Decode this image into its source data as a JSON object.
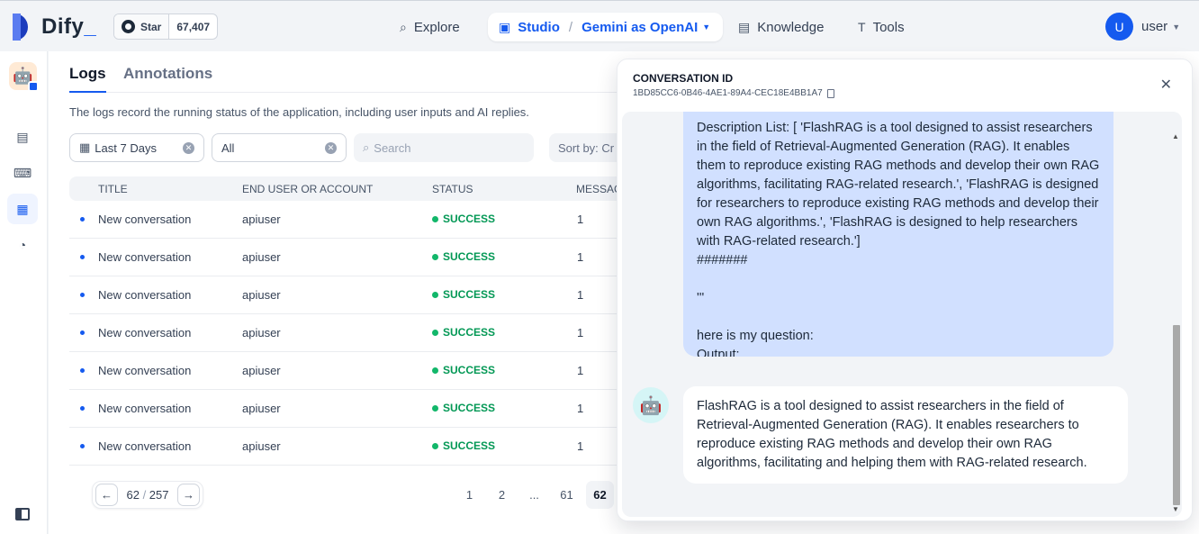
{
  "brand": {
    "name": "Dify",
    "underscore": "_"
  },
  "github": {
    "label": "Star",
    "count": "67,407"
  },
  "nav": {
    "explore": "Explore",
    "studio": "Studio",
    "app_name": "Gemini as OpenAI",
    "knowledge": "Knowledge",
    "tools": "Tools"
  },
  "user": {
    "initial": "U",
    "name": "user"
  },
  "tabs": {
    "logs": "Logs",
    "annotations": "Annotations"
  },
  "description": "The logs record the running status of the application, including user inputs and AI replies.",
  "filters": {
    "date": "Last 7 Days",
    "status": "All",
    "search_placeholder": "Search",
    "sort": "Sort by: Cr"
  },
  "table": {
    "headers": [
      "TITLE",
      "END USER OR ACCOUNT",
      "STATUS",
      "MESSAG"
    ],
    "rows": [
      {
        "title": "New conversation",
        "user": "apiuser",
        "status": "SUCCESS",
        "messages": "1"
      },
      {
        "title": "New conversation",
        "user": "apiuser",
        "status": "SUCCESS",
        "messages": "1"
      },
      {
        "title": "New conversation",
        "user": "apiuser",
        "status": "SUCCESS",
        "messages": "1"
      },
      {
        "title": "New conversation",
        "user": "apiuser",
        "status": "SUCCESS",
        "messages": "1"
      },
      {
        "title": "New conversation",
        "user": "apiuser",
        "status": "SUCCESS",
        "messages": "1"
      },
      {
        "title": "New conversation",
        "user": "apiuser",
        "status": "SUCCESS",
        "messages": "1"
      },
      {
        "title": "New conversation",
        "user": "apiuser",
        "status": "SUCCESS",
        "messages": "1"
      }
    ]
  },
  "pagination": {
    "current": "62",
    "total": "257",
    "pages": [
      "1",
      "2",
      "...",
      "61",
      "62"
    ]
  },
  "drawer": {
    "title": "CONVERSATION ID",
    "conversation_id": "1BD85CC6-0B46-4AE1-89A4-CEC18E4BB1A7",
    "question": "Description List: [ 'FlashRAG is a tool designed to assist researchers in the field of Retrieval-Augmented Generation (RAG). It enables them to reproduce existing RAG methods and develop their own RAG algorithms, facilitating RAG-related research.', 'FlashRAG is designed for researchers to reproduce existing RAG methods and develop their own RAG algorithms.', 'FlashRAG is designed to help researchers with RAG-related research.']\n#######\n\n'''\n\nhere is my question:\nOutput:",
    "answer": "FlashRAG is a tool designed to assist researchers in the field of Retrieval-Augmented Generation (RAG). It enables researchers to reproduce existing RAG methods and develop their own RAG algorithms, facilitating and helping them with RAG-related research."
  },
  "colors": {
    "accent": "#155aef",
    "success": "#039855",
    "bubble_user": "#d1e0ff"
  },
  "icons": {
    "explore": "compass-icon",
    "studio": "robot-icon",
    "knowledge": "book-icon",
    "tools": "tool-icon"
  }
}
